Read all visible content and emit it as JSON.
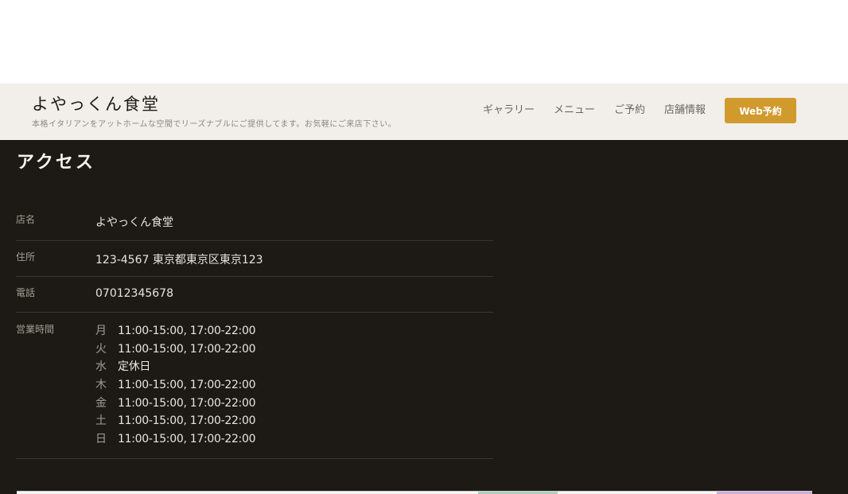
{
  "header": {
    "site_title": "よやっくん食堂",
    "tagline": "本格イタリアンをアットホームな空間でリーズナブルにご提供してます。お気軽にご来店下さい。",
    "nav": [
      "ギャラリー",
      "メニュー",
      "ご予約",
      "店舗情報"
    ],
    "cta_label": "Web予約",
    "accent_color": "#d09a2c"
  },
  "access": {
    "title": "アクセス",
    "rows": [
      {
        "label": "店名",
        "value": "よやっくん食堂"
      },
      {
        "label": "住所",
        "value": "123-4567 東京都東京区東京123"
      },
      {
        "label": "電話",
        "value": "07012345678"
      }
    ],
    "hours_label": "営業時間",
    "hours": [
      {
        "day": "月",
        "time": "11:00-15:00, 17:00-22:00"
      },
      {
        "day": "火",
        "time": "11:00-15:00, 17:00-22:00"
      },
      {
        "day": "水",
        "time": "定休日"
      },
      {
        "day": "木",
        "time": "11:00-15:00, 17:00-22:00"
      },
      {
        "day": "金",
        "time": "11:00-15:00, 17:00-22:00"
      },
      {
        "day": "土",
        "time": "11:00-15:00, 17:00-22:00"
      },
      {
        "day": "日",
        "time": "11:00-15:00, 17:00-22:00"
      }
    ]
  }
}
